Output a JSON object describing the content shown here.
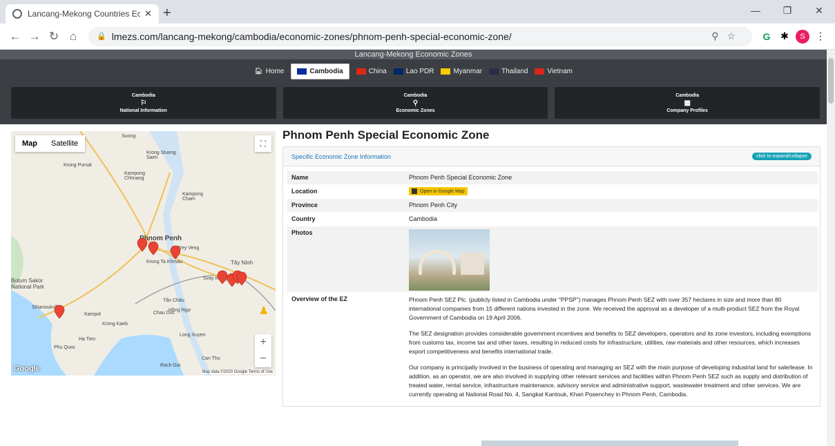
{
  "browser": {
    "tab_title": "Lancang-Mekong Countries Econ",
    "url": "lmezs.com/lancang-mekong/cambodia/economic-zones/phnom-penh-special-economic-zone/"
  },
  "site": {
    "title": "Lancang-Mekong Economic Zones",
    "nav": {
      "home": "Home",
      "countries": [
        {
          "label": "Cambodia",
          "active": true,
          "flag": "#032ea1"
        },
        {
          "label": "China",
          "flag": "#de2910"
        },
        {
          "label": "Lao PDR",
          "flag": "#002868"
        },
        {
          "label": "Myanmar",
          "flag": "#fecb00"
        },
        {
          "label": "Thailand",
          "flag": "#2d2a4a"
        },
        {
          "label": "Vietnam",
          "flag": "#da251d"
        }
      ]
    },
    "cards": [
      {
        "country": "Cambodia",
        "label": "National Information",
        "icon": "flag-icon"
      },
      {
        "country": "Cambodia",
        "label": "Economic Zones",
        "icon": "map-marker-icon"
      },
      {
        "country": "Cambodia",
        "label": "Company Profiles",
        "icon": "building-icon"
      }
    ]
  },
  "map": {
    "type_map": "Map",
    "type_satellite": "Satellite",
    "logo": "Google",
    "attribution": "Map data ©2020 Google   Terms of Use",
    "labels": [
      "Phnom Penh",
      "Krong Ta Khmau",
      "Prey Veng",
      "Tây Ninh",
      "Svay Rieng",
      "Chau Doc",
      "Long Xuyen",
      "Can Tho",
      "Rach Gia",
      "Ha Tien",
      "Phu Quoc",
      "Kampot",
      "Krong Kaeb",
      "Botum Sakor National Park",
      "Krong Pursat",
      "Kampong Chhnang",
      "Kampong Cham",
      "Tân Châu",
      "Hồng Ngự",
      "Krong Stueng Saen",
      "Suong",
      "Sihanoukville"
    ]
  },
  "page": {
    "title": "Phnom Penh Special Economic Zone",
    "panel_title": "Specific Economic Zone Information",
    "toggle": "click to expand/collapse",
    "rows": {
      "name": {
        "label": "Name",
        "value": "Phnom Penh Special Economic Zone"
      },
      "location": {
        "label": "Location",
        "button": "Open in Google Map"
      },
      "province": {
        "label": "Province",
        "value": "Phnom Penh City"
      },
      "country": {
        "label": "Country",
        "value": "Cambodia"
      },
      "photos": {
        "label": "Photos"
      },
      "overview": {
        "label": "Overview of the EZ",
        "paragraphs": [
          "Phnom Penh SEZ Plc. (publicly listed in Cambodia under \"PPSP\") manages Phnom Penh SEZ with over 357 hectares in size and more than 80 international companies from 15 different nations invested in the zone. We received the approval as a developer of a multi-product SEZ from the Royal Government of Cambodia on 19 April 2006.",
          "The SEZ designation provides considerable government incentives and benefits to SEZ developers, operators and its zone investors, including exemptions from customs tax, income tax and other taxes, resulting in reduced costs for infrastructure, utilities, raw materials and other resources, which increases export competitiveness and benefits international trade.",
          "Our company is principally involved in the business of operating and managing an SEZ with the main purpose of developing industrial land for sale/lease. In addition, as an operator, we are also involved in supplying other relevant services and facilities within Phnom Penh SEZ such as supply and distribution of treated water, rental service, infrastructure maintenance, advisory service and administrative support, wastewater treatment and other services. We are currently operating at National Road No. 4, Sangkat Kantouk, Khan Posenchey in Phnom Penh, Cambodia."
        ]
      }
    }
  }
}
